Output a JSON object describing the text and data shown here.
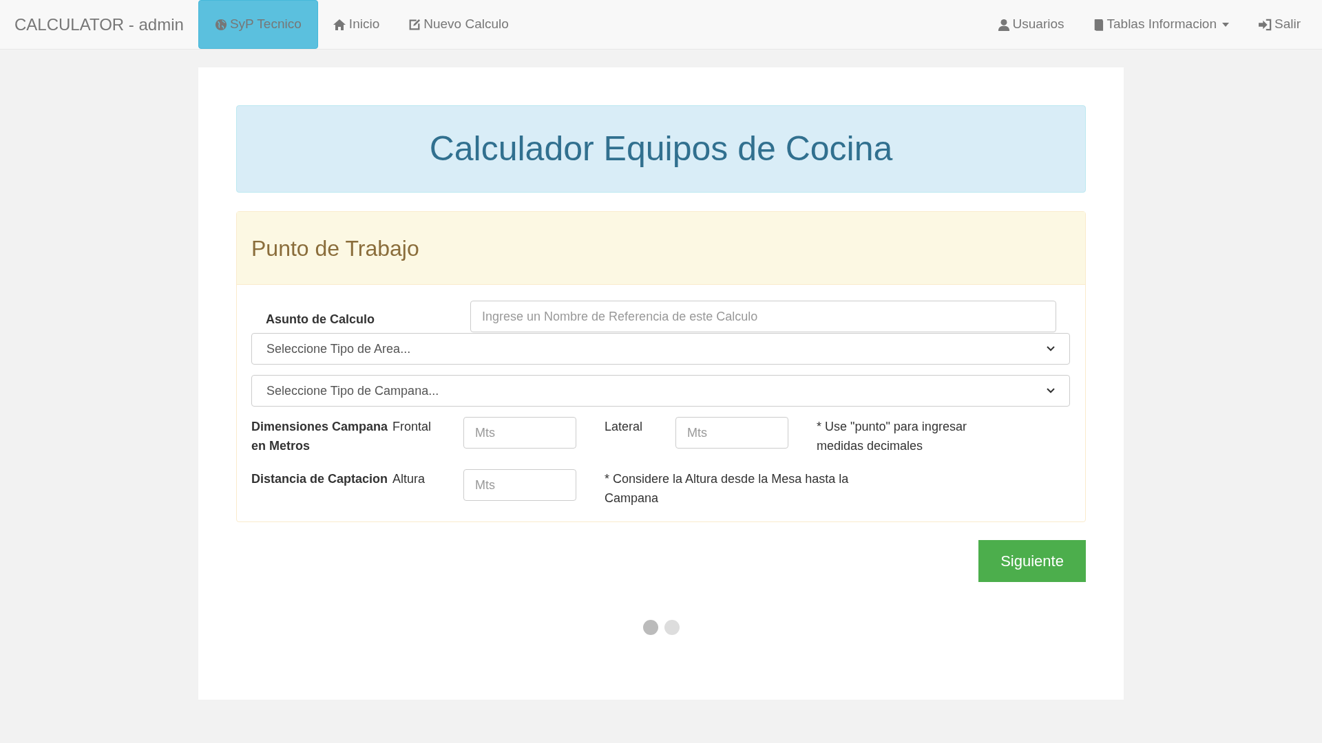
{
  "navbar": {
    "brand": "CALCULATOR - admin",
    "left_items": [
      {
        "label": "SyP Tecnico",
        "selected": true
      },
      {
        "label": "Inicio",
        "selected": false
      },
      {
        "label": "Nuevo Calculo",
        "selected": false
      }
    ],
    "right_items": [
      {
        "label": "Usuarios",
        "dropdown": false
      },
      {
        "label": "Tablas Informacion",
        "dropdown": true
      },
      {
        "label": "Salir",
        "dropdown": false
      }
    ]
  },
  "header": {
    "title": "Calculador Equipos de Cocina"
  },
  "panel": {
    "title": "Punto de Trabajo",
    "subject": {
      "label": "Asunto de Calculo",
      "placeholder": "Ingrese un Nombre de Referencia de este Calculo"
    },
    "selects": [
      {
        "placeholder": "Seleccione Tipo de Area..."
      },
      {
        "placeholder": "Seleccione Tipo de Campana..."
      }
    ],
    "rows": [
      {
        "label": "Dimensiones Campana en Metros",
        "fields": [
          {
            "label": "Frontal",
            "placeholder": "Mts"
          },
          {
            "label": "Lateral",
            "placeholder": "Mts"
          }
        ],
        "note": "* Use \"punto\" para ingresar medidas decimales"
      },
      {
        "label": "Distancia de Captacion",
        "fields": [
          {
            "label": "Altura",
            "placeholder": "Mts"
          }
        ],
        "note": "* Considere la Altura desde la Mesa hasta la Campana"
      }
    ]
  },
  "next_button": "Siguiente",
  "pager_dots": [
    {
      "selected": true
    },
    {
      "selected": false
    }
  ]
}
